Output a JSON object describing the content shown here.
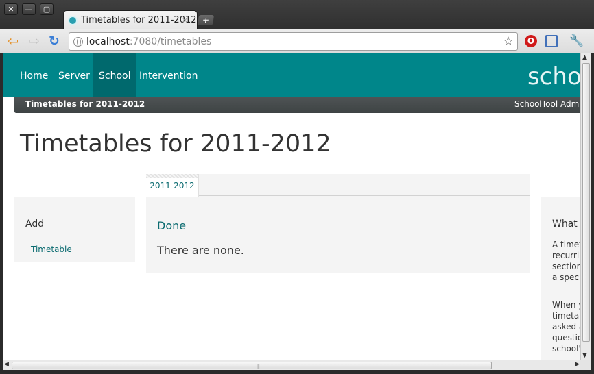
{
  "window": {
    "close_glyph": "✕",
    "minimize_glyph": "—",
    "maximize_glyph": "▢"
  },
  "tab": {
    "title": "Timetables for 2011-2012",
    "close_glyph": "×",
    "new_tab_glyph": "+",
    "favicon_color": "#2a9fb0"
  },
  "toolbar": {
    "back_glyph": "⇦",
    "forward_glyph": "⇨",
    "reload_glyph": "↻",
    "url_host": "localhost",
    "url_path": ":7080/timetables",
    "star_glyph": "☆",
    "opera_glyph": "O",
    "wrench_glyph": "🔧",
    "icons": [
      "back-arrow-icon",
      "forward-arrow-icon",
      "reload-icon",
      "globe-icon",
      "bookmark-star-icon",
      "opera-icon",
      "fullscreen-icon",
      "wrench-icon"
    ]
  },
  "site": {
    "brand_color": "#00868a",
    "nav": {
      "items": [
        {
          "label": "Home"
        },
        {
          "label": "Server"
        },
        {
          "label": "School",
          "active": true
        },
        {
          "label": "Intervention"
        }
      ]
    },
    "brand": "schoo",
    "subbar": {
      "title": "Timetables for 2011-2012",
      "user": "SchoolTool Admini"
    }
  },
  "page": {
    "title": "Timetables for 2011-2012",
    "left": {
      "heading": "Add",
      "link": "Timetable"
    },
    "center": {
      "tab": "2011-2012",
      "section_heading": "Done",
      "empty_text": "There are none."
    },
    "right": {
      "heading": "What is",
      "para1": "A timetable recurring section during a specified",
      "para2": "When you timetable asked a question school's"
    }
  },
  "scrollbars": {
    "up_glyph": "▲",
    "down_glyph": "▼",
    "left_glyph": "◀",
    "right_glyph": "▶",
    "grip": "|||"
  }
}
